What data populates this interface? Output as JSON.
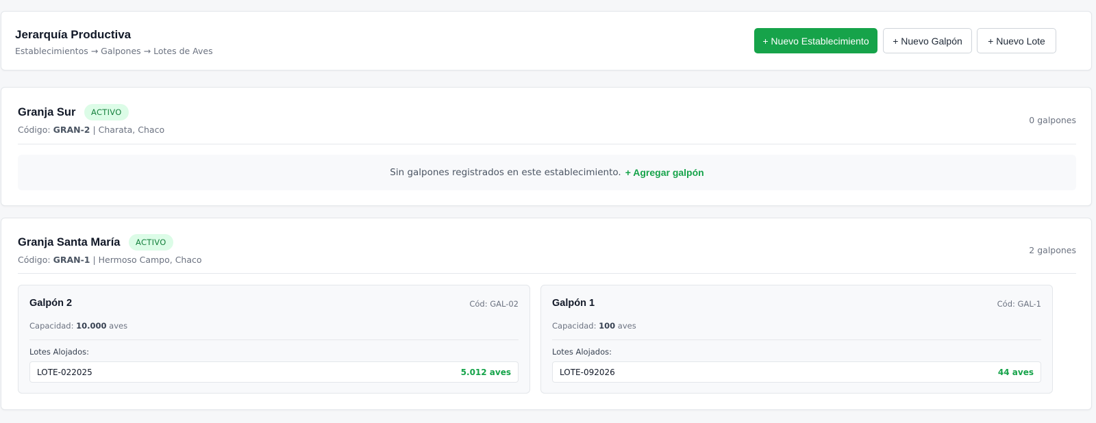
{
  "header": {
    "title": "Jerarquía Productiva",
    "subtitle": "Establecimientos → Galpones → Lotes de Aves",
    "buttons": {
      "new_establishment": "+ Nuevo Establecimiento",
      "new_shed": "+ Nuevo Galpón",
      "new_batch": "+ Nuevo Lote"
    }
  },
  "colors": {
    "accent": "#16a34a",
    "badge_bg": "#dcfce7",
    "badge_text": "#15803d"
  },
  "establishments": [
    {
      "name": "Granja Sur",
      "status": "ACTIVO",
      "code_label": "Código:",
      "code": "GRAN-2",
      "location": "Charata, Chaco",
      "count": "0 galpones",
      "empty_text": "Sin galpones registrados en este establecimiento.",
      "add_link": "+ Agregar galpón"
    },
    {
      "name": "Granja Santa María",
      "status": "ACTIVO",
      "code_label": "Código:",
      "code": "GRAN-1",
      "location": "Hermoso Campo, Chaco",
      "count": "2 galpones",
      "sheds": [
        {
          "name": "Galpón 2",
          "code": "Cód: GAL-02",
          "capacity_label": "Capacidad:",
          "capacity": "10.000",
          "capacity_unit": "aves",
          "lotes_label": "Lotes Alojados:",
          "lotes": [
            {
              "name": "LOTE-022025",
              "aves": "5.012 aves"
            }
          ]
        },
        {
          "name": "Galpón 1",
          "code": "Cód: GAL-1",
          "capacity_label": "Capacidad:",
          "capacity": "100",
          "capacity_unit": "aves",
          "lotes_label": "Lotes Alojados:",
          "lotes": [
            {
              "name": "LOTE-092026",
              "aves": "44 aves"
            }
          ]
        }
      ]
    }
  ]
}
